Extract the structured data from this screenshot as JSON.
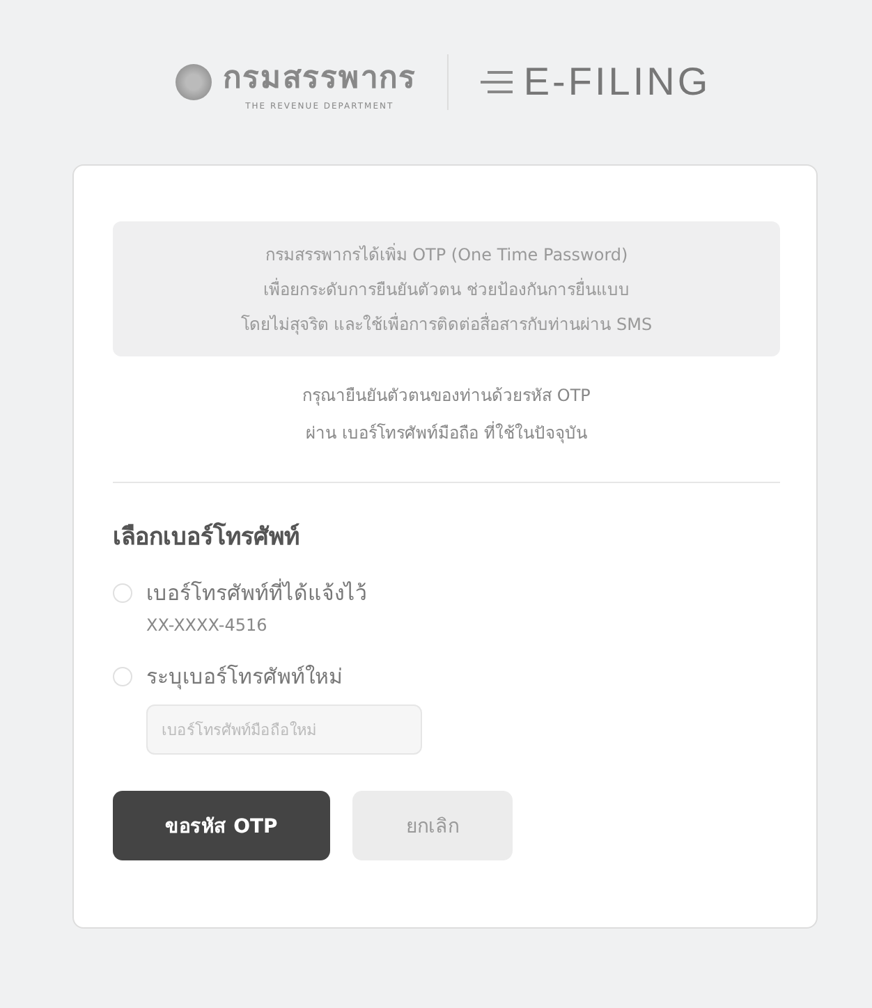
{
  "header": {
    "department_name": "กรมสรรพากร",
    "department_subtitle": "THE REVENUE DEPARTMENT",
    "system_name": "E-FILING"
  },
  "notice": [
    "กรมสรรพากรได้เพิ่ม OTP (One Time Password)",
    "เพื่อยกระดับการยืนยันตัวตน ช่วยป้องกันการยื่นแบบ",
    "โดยไม่สุจริต และใช้เพื่อการติดต่อสื่อสารกับท่านผ่าน SMS"
  ],
  "instruction": [
    "กรุณายืนยันตัวตนของท่านด้วยรหัส OTP",
    "ผ่าน เบอร์โทรศัพท์มือถือ ที่ใช้ในปัจจุบัน"
  ],
  "section_title": "เลือกเบอร์โทรศัพท์",
  "options": [
    {
      "label": "เบอร์โทรศัพท์ที่ได้แจ้งไว้",
      "selected": false,
      "kind": "registered",
      "detail": "XX-XXXX-4516"
    },
    {
      "label": "ระบุเบอร์โทรศัพท์ใหม่",
      "selected": false,
      "kind": "new",
      "placeholder": "เบอร์โทรศัพท์มือถือใหม่"
    }
  ],
  "buttons": [
    {
      "label": "ขอรหัส OTP",
      "kind": "primary"
    },
    {
      "label": "ยกเลิก",
      "kind": "secondary"
    }
  ]
}
